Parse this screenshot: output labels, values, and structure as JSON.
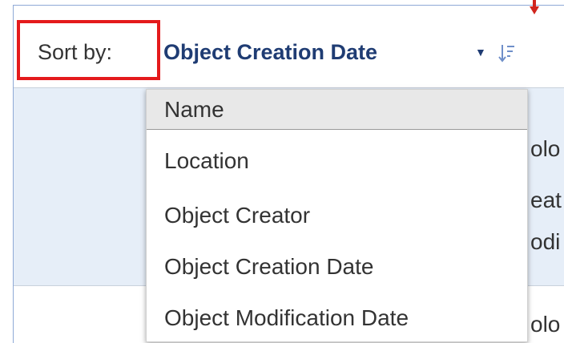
{
  "sort": {
    "label": "Sort by:",
    "selected": "Object Creation Date",
    "caret": "▼",
    "order_icon": "sort-descending-icon"
  },
  "dropdown": {
    "options": [
      "Name",
      "Location",
      "Object Creator",
      "Object Creation Date",
      "Object Modification Date"
    ]
  },
  "background_peek": [
    "olo",
    "eat",
    "odi",
    "olo"
  ],
  "colors": {
    "highlight_box": "#e41a1c",
    "arrow": "#d0251e",
    "selected_text": "#1f3c73",
    "row_band": "#e6eef8"
  }
}
